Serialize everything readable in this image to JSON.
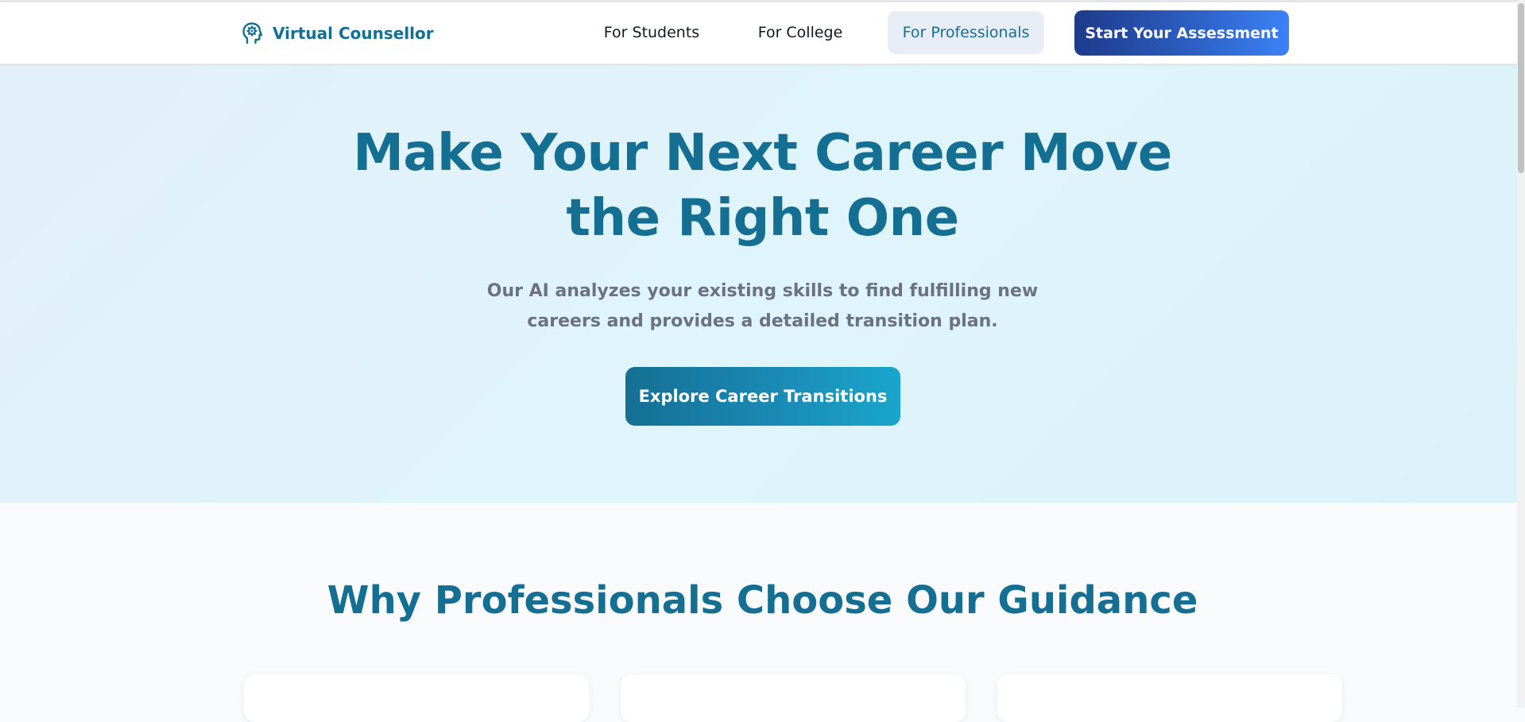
{
  "brand": {
    "name": "Virtual Counsellor",
    "icon": "head-gear-icon"
  },
  "nav": {
    "items": [
      {
        "label": "For Students"
      },
      {
        "label": "For College"
      },
      {
        "label": "For Professionals",
        "active": true
      }
    ],
    "cta_label": "Start Your Assessment"
  },
  "hero": {
    "title_line1": "Make Your Next Career Move",
    "title_line2": "the Right One",
    "subtitle_line1": "Our AI analyzes your existing skills to find fulfilling new",
    "subtitle_line2": "careers and provides a detailed transition plan.",
    "cta_label": "Explore Career Transitions"
  },
  "features": {
    "title": "Why Professionals Choose Our Guidance"
  },
  "colors": {
    "primary": "#156f93",
    "nav_cta_start": "#1e3a8a",
    "nav_cta_end": "#3b82f6",
    "hero_bg": "#e0f4fb",
    "active_nav_bg": "#e8edf5",
    "muted_text": "#6b7280"
  }
}
